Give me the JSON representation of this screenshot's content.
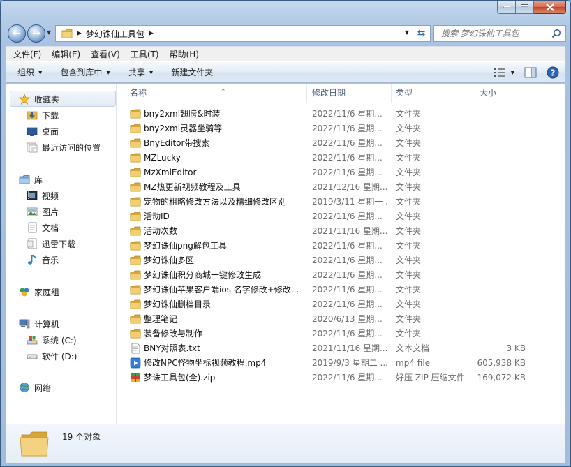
{
  "window": {
    "breadcrumb": "梦幻诛仙工具包",
    "search_placeholder": "搜索 梦幻诛仙工具包"
  },
  "menu": [
    "文件(F)",
    "编辑(E)",
    "查看(V)",
    "工具(T)",
    "帮助(H)"
  ],
  "toolbar": {
    "organize": "组织",
    "include_library": "包含到库中",
    "share": "共享",
    "new_folder": "新建文件夹"
  },
  "sidebar": {
    "favorites": "收藏夹",
    "downloads": "下载",
    "desktop": "桌面",
    "recent": "最近访问的位置",
    "libraries": "库",
    "videos": "视频",
    "pictures": "图片",
    "documents": "文档",
    "thunder": "迅雷下载",
    "music": "音乐",
    "homegroup": "家庭组",
    "computer": "计算机",
    "drive_c": "系统 (C:)",
    "drive_d": "软件 (D:)",
    "network": "网络"
  },
  "columns": {
    "name": "名称",
    "date": "修改日期",
    "type": "类型",
    "size": "大小"
  },
  "files": [
    {
      "name": "bny2xml翅膀&时装",
      "date": "2022/11/6 星期...",
      "type": "文件夹",
      "size": "",
      "icon": "folder"
    },
    {
      "name": "bny2xml灵器坐骑等",
      "date": "2022/11/6 星期...",
      "type": "文件夹",
      "size": "",
      "icon": "folder"
    },
    {
      "name": "BnyEditor带搜索",
      "date": "2022/11/6 星期...",
      "type": "文件夹",
      "size": "",
      "icon": "folder"
    },
    {
      "name": "MZLucky",
      "date": "2022/11/6 星期...",
      "type": "文件夹",
      "size": "",
      "icon": "folder"
    },
    {
      "name": "MzXmlEditor",
      "date": "2022/11/6 星期...",
      "type": "文件夹",
      "size": "",
      "icon": "folder"
    },
    {
      "name": "MZ热更新视频教程及工具",
      "date": "2021/12/16 星期...",
      "type": "文件夹",
      "size": "",
      "icon": "folder"
    },
    {
      "name": "宠物的粗略修改方法以及精细修改区别",
      "date": "2019/3/11 星期一 ...",
      "type": "文件夹",
      "size": "",
      "icon": "folder"
    },
    {
      "name": "活动ID",
      "date": "2022/11/6 星期...",
      "type": "文件夹",
      "size": "",
      "icon": "folder"
    },
    {
      "name": "活动次数",
      "date": "2021/11/16 星期...",
      "type": "文件夹",
      "size": "",
      "icon": "folder"
    },
    {
      "name": "梦幻诛仙png解包工具",
      "date": "2022/11/6 星期...",
      "type": "文件夹",
      "size": "",
      "icon": "folder"
    },
    {
      "name": "梦幻诛仙多区",
      "date": "2022/11/6 星期...",
      "type": "文件夹",
      "size": "",
      "icon": "folder"
    },
    {
      "name": "梦幻诛仙积分商城一键修改生成",
      "date": "2022/11/6 星期...",
      "type": "文件夹",
      "size": "",
      "icon": "folder"
    },
    {
      "name": "梦幻诛仙苹果客户端ios 名字修改+修改...",
      "date": "2022/11/6 星期...",
      "type": "文件夹",
      "size": "",
      "icon": "folder"
    },
    {
      "name": "梦幻诛仙删档目录",
      "date": "2022/11/6 星期...",
      "type": "文件夹",
      "size": "",
      "icon": "folder"
    },
    {
      "name": "整理笔记",
      "date": "2020/6/13 星期...",
      "type": "文件夹",
      "size": "",
      "icon": "folder"
    },
    {
      "name": "装备修改与制作",
      "date": "2022/11/6 星期...",
      "type": "文件夹",
      "size": "",
      "icon": "folder"
    },
    {
      "name": "BNY对照表.txt",
      "date": "2021/11/16 星期...",
      "type": "文本文档",
      "size": "3 KB",
      "icon": "txt"
    },
    {
      "name": "修改NPC怪物坐标视频教程.mp4",
      "date": "2019/9/3 星期二 ...",
      "type": "mp4 file",
      "size": "605,938 KB",
      "icon": "video"
    },
    {
      "name": "梦诛工具包(全).zip",
      "date": "2022/11/6 星期...",
      "type": "好压 ZIP 压缩文件",
      "size": "169,072 KB",
      "icon": "zip"
    }
  ],
  "status": {
    "count": "19 个对象"
  }
}
